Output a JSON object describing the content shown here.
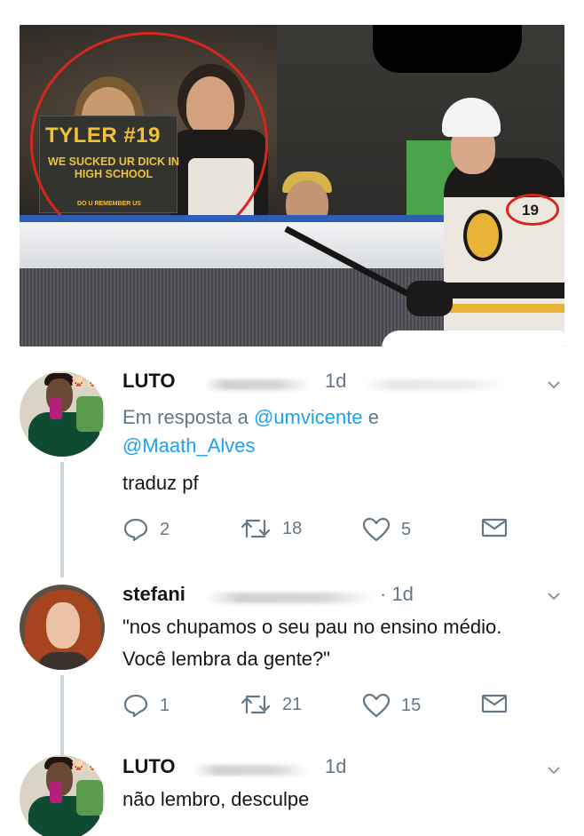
{
  "photo": {
    "sign_line1": "TYLER #19",
    "sign_line2": "WE SUCKED UR DICK IN HIGH SCHOOL",
    "sign_line3": "DO U REMEMBER US",
    "jersey_number": "19"
  },
  "tweets": [
    {
      "name": "LUTO",
      "time": "1d",
      "reply_prefix": "Em resposta a",
      "mention1": "@umvicente",
      "conjunction": "e",
      "mention2": "@Maath_Alves",
      "text": "traduz pf",
      "replies": "2",
      "retweets": "18",
      "likes": "5"
    },
    {
      "name": "stefani",
      "time": "· 1d",
      "text": "\"nos chupamos o seu pau no ensino médio. Você lembra da gente?\"",
      "replies": "1",
      "retweets": "21",
      "likes": "15"
    },
    {
      "name": "LUTO",
      "time": "1d",
      "text": "não lembro, desculpe"
    }
  ],
  "icons": [
    "reply-icon",
    "retweet-icon",
    "like-icon",
    "message-icon",
    "chevron-down-icon"
  ],
  "colors": {
    "text": "#14171a",
    "muted": "#657786",
    "link": "#1da1f2",
    "thread_line": "#ccd6dd",
    "highlight_circle": "#d7261e"
  }
}
